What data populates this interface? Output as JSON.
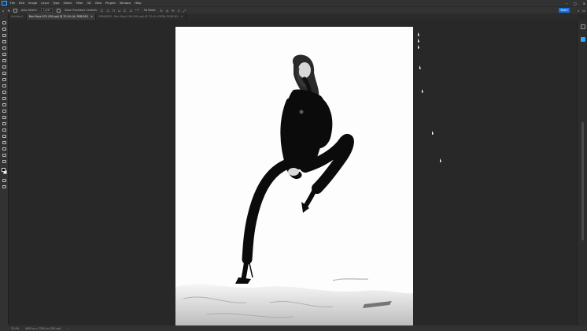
{
  "menubar": {
    "items": [
      "File",
      "Edit",
      "Image",
      "Layer",
      "Type",
      "Select",
      "Filter",
      "3D",
      "View",
      "Plugins",
      "Window",
      "Help"
    ]
  },
  "options": {
    "auto_select": "Auto-Select:",
    "layer": "Layer",
    "show_transform": "Show Transform Controls",
    "more": "•••",
    "mode_3d": "3D Mode:",
    "share": "Share"
  },
  "tabs": [
    {
      "label": "Untitled-1",
      "active": false
    },
    {
      "label": "Ben Maye 079 (300 ppi) @ 33.4% (#, RGB/16*)",
      "active": true
    },
    {
      "label": "CKRN0563 - Ben Maye 106 (300 ppi) @ 33.4% (CKRN, RGB/16*)",
      "active": false
    }
  ],
  "tab_close": "×",
  "statusbar": {
    "zoom": "33.4%",
    "doc_info": "4800 px x 7200 px (300 ppi)",
    "arrow": "›"
  },
  "colors": {
    "accent": "#31a8ff",
    "share": "#1473e6",
    "app_bg": "#282828",
    "panel_bg": "#323232"
  },
  "icons": {
    "move_tool": "move-icon",
    "home": "home-icon",
    "search": "search-icon",
    "workspace": "workspace-icon",
    "settings": "gear-icon"
  }
}
